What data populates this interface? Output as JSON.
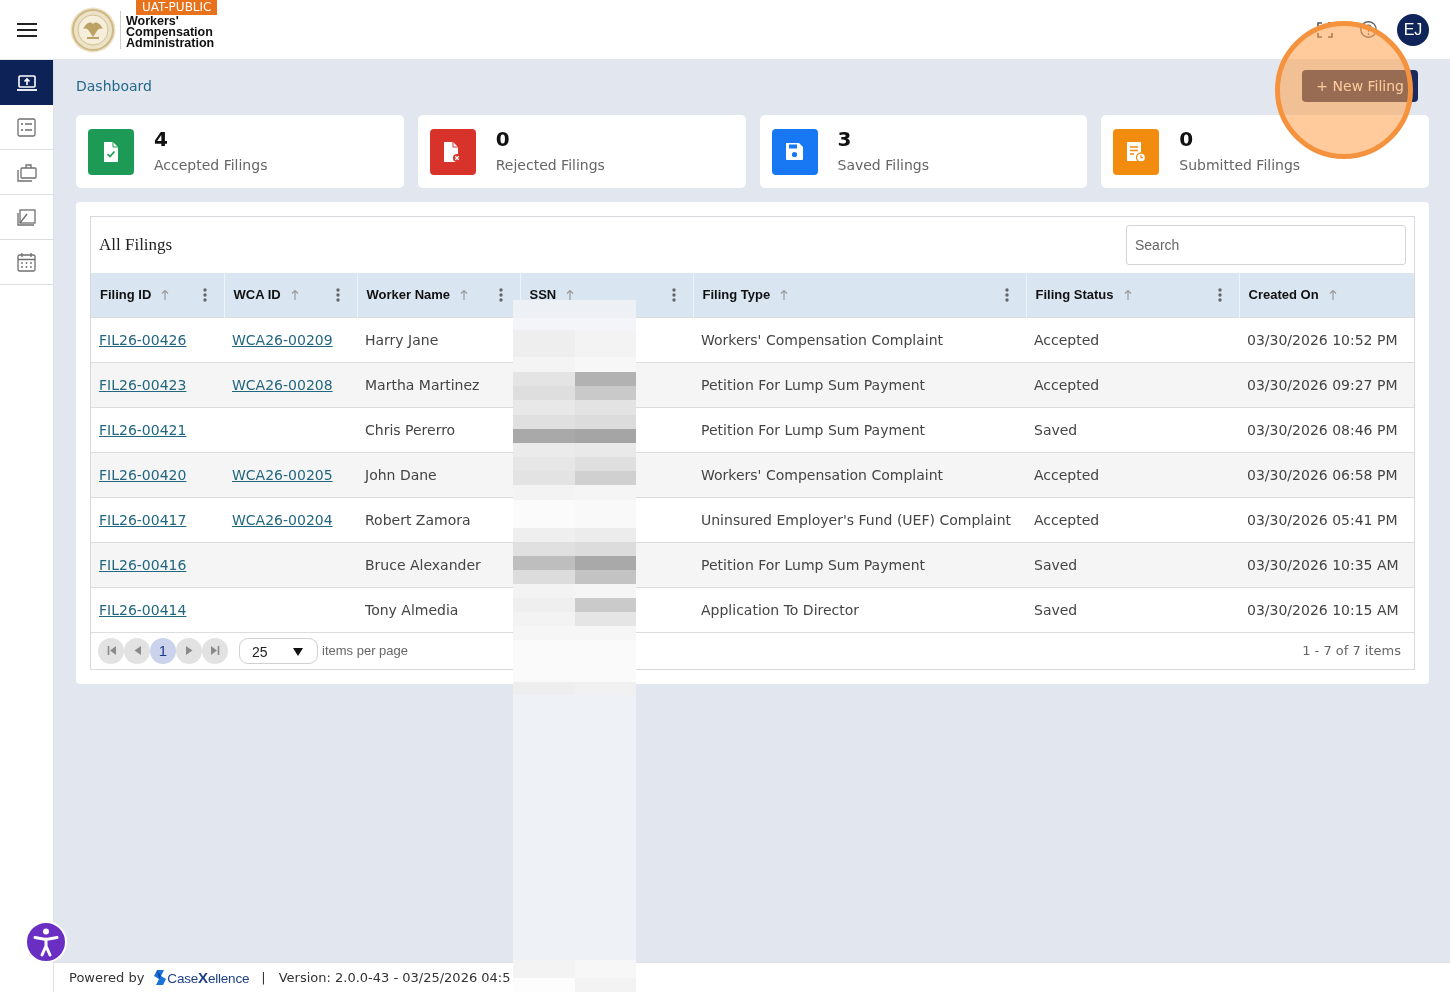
{
  "header": {
    "badge": "UAT-PUBLIC",
    "agency_name": "Workers' Compensation Administration",
    "avatar_initials": "EJ"
  },
  "sidebar": {
    "items": [
      {
        "selected": true
      },
      {
        "selected": false
      },
      {
        "selected": false
      },
      {
        "selected": false
      },
      {
        "selected": false
      }
    ]
  },
  "breadcrumb": "Dashboard",
  "new_filing_button": "+ New Filing",
  "stats": [
    {
      "kind": "accepted",
      "value": "4",
      "label": "Accepted Filings",
      "color": "#1e9a57"
    },
    {
      "kind": "rejected",
      "value": "0",
      "label": "Rejected Filings",
      "color": "#d8332a"
    },
    {
      "kind": "saved",
      "value": "3",
      "label": "Saved Filings",
      "color": "#1877f2"
    },
    {
      "kind": "submitted",
      "value": "0",
      "label": "Submitted Filings",
      "color": "#f28c0f"
    }
  ],
  "filings": {
    "title": "All Filings",
    "search": {
      "placeholder": "Search"
    },
    "columns": [
      {
        "label": "Filing ID",
        "menu": true
      },
      {
        "label": "WCA ID",
        "menu": true
      },
      {
        "label": "Worker Name",
        "menu": true
      },
      {
        "label": "SSN",
        "menu": true
      },
      {
        "label": "Filing Type",
        "menu": true
      },
      {
        "label": "Filing Status",
        "menu": true
      },
      {
        "label": "Created On",
        "menu": false
      }
    ],
    "rows": [
      {
        "filing_id": "FIL26-00426",
        "wca_id": "WCA26-00209",
        "worker_name": "Harry Jane",
        "filing_type": "Workers' Compensation Complaint",
        "filing_status": "Accepted",
        "created_on": "03/30/2026 10:52 PM"
      },
      {
        "filing_id": "FIL26-00423",
        "wca_id": "WCA26-00208",
        "worker_name": "Martha Martinez",
        "filing_type": "Petition For Lump Sum Payment",
        "filing_status": "Accepted",
        "created_on": "03/30/2026 09:27 PM"
      },
      {
        "filing_id": "FIL26-00421",
        "worker_name": "Chris Pererro",
        "filing_type": "Petition For Lump Sum Payment",
        "filing_status": "Saved",
        "created_on": "03/30/2026 08:46 PM"
      },
      {
        "filing_id": "FIL26-00420",
        "wca_id": "WCA26-00205",
        "worker_name": "John Dane",
        "filing_type": "Workers' Compensation Complaint",
        "filing_status": "Accepted",
        "created_on": "03/30/2026 06:58 PM"
      },
      {
        "filing_id": "FIL26-00417",
        "wca_id": "WCA26-00204",
        "worker_name": "Robert Zamora",
        "filing_type": "Uninsured Employer's Fund (UEF) Complaint",
        "filing_status": "Accepted",
        "created_on": "03/30/2026 05:41 PM"
      },
      {
        "filing_id": "FIL26-00416",
        "worker_name": "Bruce Alexander",
        "filing_type": "Petition For Lump Sum Payment",
        "filing_status": "Saved",
        "created_on": "03/30/2026 10:35 AM"
      },
      {
        "filing_id": "FIL26-00414",
        "worker_name": "Tony Almedia",
        "filing_type": "Application To Director",
        "filing_status": "Saved",
        "created_on": "03/30/2026 10:15 AM"
      }
    ],
    "pagination": {
      "pages": [
        {
          "label": "1",
          "selected": true
        }
      ],
      "page_size": "25",
      "page_size_label": "items per page",
      "summary": "1 - 7 of 7 items"
    }
  },
  "footer": {
    "powered_by": "Powered by",
    "brand": "Case**X**ellence",
    "separator": "|",
    "version": "Version: 2.0.0-43 - 03/25/2026 04:5"
  }
}
